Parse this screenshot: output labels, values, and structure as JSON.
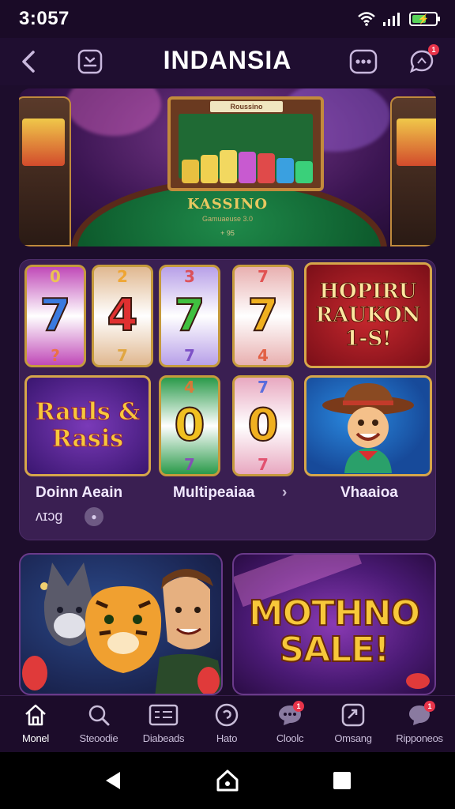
{
  "status_bar": {
    "time": "3:057",
    "battery_level": 0.6
  },
  "header": {
    "title": "INDANSIA",
    "chat_badge": "1"
  },
  "hero": {
    "board_title": "Roussino",
    "table_label": "KASSINO",
    "table_sub": "Gamuaeuse 3.0",
    "table_sub2": "+ 95"
  },
  "reels": [
    {
      "top": "0",
      "mid": "7",
      "bot": "?",
      "bg": "#c04ab8"
    },
    {
      "top": "2",
      "mid": "4",
      "bot": "7",
      "bg": "#e0b890"
    },
    {
      "top": "3",
      "mid": "7",
      "bot": "7",
      "bg": "#b8a0e8"
    },
    {
      "top": "7",
      "mid": "7",
      "bot": "4",
      "bg": "#e8b0b0"
    }
  ],
  "reels_row2": [
    {
      "top": "4",
      "mid": "0",
      "bot": "7",
      "bg": "#2a9a4a"
    },
    {
      "top": "7",
      "mid": "0",
      "bot": "7",
      "bg": "#e8a8c0"
    }
  ],
  "promo_tile": {
    "text": "HOPIRU RAUKON 1-S!"
  },
  "rauls_tile": {
    "text": "Rauls & Rasis"
  },
  "panel_labels": {
    "left": "Doinn Aeain",
    "left_sub": "ʌɪɔɡ",
    "middle": "Multipeaiaa",
    "right": "Vhaaioa"
  },
  "promo_cards": {
    "sale_text": "MOTHNO SALE!"
  },
  "bottom_nav": [
    {
      "label": "Monel",
      "icon": "home-icon"
    },
    {
      "label": "Steoodie",
      "icon": "search-icon"
    },
    {
      "label": "Diabeads",
      "icon": "list-icon"
    },
    {
      "label": "Hato",
      "icon": "coin-icon"
    },
    {
      "label": "Cloolc",
      "icon": "chat-icon"
    },
    {
      "label": "Omsang",
      "icon": "share-icon"
    },
    {
      "label": "Ripponeos",
      "icon": "message-icon"
    }
  ],
  "nav_badges": {
    "chat": "1",
    "messages": "1"
  },
  "colors": {
    "background": "#1d0d2c",
    "panel": "#3a1f52",
    "accent_gold": "#f7c83a",
    "badge_red": "#e8344a"
  }
}
